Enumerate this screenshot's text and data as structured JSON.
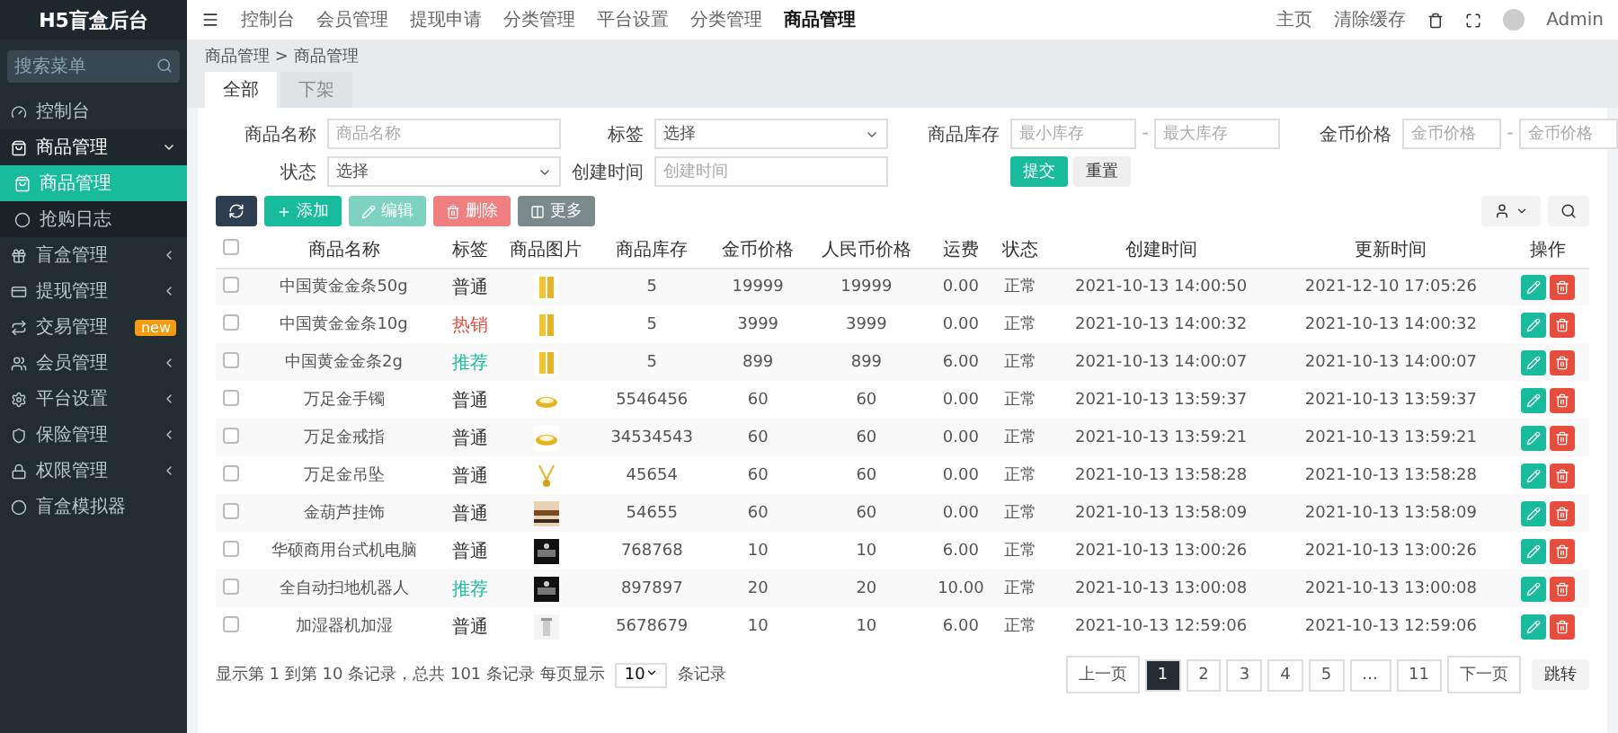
{
  "app_title": "H5盲盒后台",
  "sidebar": {
    "search": {
      "placeholder": "搜索菜单"
    },
    "items": [
      {
        "label": "控制台",
        "expanded": false,
        "selected": false
      },
      {
        "label": "商品管理",
        "expanded": true,
        "selected": false,
        "children": [
          {
            "label": "商品管理",
            "selected": true
          },
          {
            "label": "抢购日志",
            "selected": false
          }
        ]
      },
      {
        "label": "盲盒管理",
        "expanded": false,
        "selected": false
      },
      {
        "label": "提现管理",
        "expanded": false,
        "selected": false
      },
      {
        "label": "交易管理",
        "expanded": false,
        "selected": false,
        "badge": "new"
      },
      {
        "label": "会员管理",
        "expanded": false,
        "selected": false
      },
      {
        "label": "平台设置",
        "expanded": false,
        "selected": false
      },
      {
        "label": "保险管理",
        "expanded": false,
        "selected": false
      },
      {
        "label": "权限管理",
        "expanded": false,
        "selected": false
      },
      {
        "label": "盲盒模拟器",
        "expanded": false,
        "selected": false
      }
    ]
  },
  "top_nav": [
    {
      "label": "控制台",
      "selected": false
    },
    {
      "label": "会员管理",
      "selected": false
    },
    {
      "label": "提现申请",
      "selected": false
    },
    {
      "label": "分类管理",
      "selected": false
    },
    {
      "label": "平台设置",
      "selected": false
    },
    {
      "label": "分类管理",
      "selected": false
    },
    {
      "label": "商品管理",
      "selected": true
    }
  ],
  "top_right": {
    "home": "主页",
    "clear_cache": "清除缓存",
    "user": "Admin"
  },
  "breadcrumb": "商品管理 > 商品管理",
  "tabs": [
    {
      "label": "全部",
      "selected": true
    },
    {
      "label": "下架",
      "selected": false
    }
  ],
  "filters": {
    "name": {
      "label": "商品名称",
      "placeholder": "商品名称"
    },
    "tag": {
      "label": "标签",
      "value": "选择"
    },
    "stock": {
      "label": "商品库存",
      "min": {
        "placeholder": "最小库存"
      },
      "separator": "-",
      "max": {
        "placeholder": "最大库存"
      }
    },
    "price": {
      "label": "金币价格",
      "min": {
        "placeholder": "金币价格"
      },
      "separator": "-",
      "max": {
        "placeholder": "金币价格"
      }
    },
    "status": {
      "label": "状态",
      "value": "选择"
    },
    "created": {
      "label": "创建时间",
      "placeholder": "创建时间"
    },
    "submit": "提交",
    "reset": "重置"
  },
  "toolbar": [
    "添加",
    "编辑",
    "删除",
    "更多"
  ],
  "table": {
    "all_checked": false,
    "columns": [
      "商品名称",
      "标签",
      "商品图片",
      "商品库存",
      "金币价格",
      "人民币价格",
      "运费",
      "状态",
      "创建时间",
      "更新时间",
      "操作"
    ],
    "rows": [
      {
        "checked": false,
        "name": "中国黄金金条50g",
        "tag": {
          "label": "普通",
          "color": "#333333"
        },
        "stock": "5",
        "coin": "19999",
        "rmb": "19999",
        "freight": "0.00",
        "status": "正常",
        "created": "2021-10-13 14:00:50",
        "updated": "2021-12-10 17:05:26"
      },
      {
        "checked": false,
        "name": "中国黄金金条10g",
        "tag": {
          "label": "热销",
          "color": "#e74c3c"
        },
        "stock": "5",
        "coin": "3999",
        "rmb": "3999",
        "freight": "0.00",
        "status": "正常",
        "created": "2021-10-13 14:00:32",
        "updated": "2021-10-13 14:00:32"
      },
      {
        "checked": false,
        "name": "中国黄金金条2g",
        "tag": {
          "label": "推荐",
          "color": "#18bc9c"
        },
        "stock": "5",
        "coin": "899",
        "rmb": "899",
        "freight": "6.00",
        "status": "正常",
        "created": "2021-10-13 14:00:07",
        "updated": "2021-10-13 14:00:07"
      },
      {
        "checked": false,
        "name": "万足金手镯",
        "tag": {
          "label": "普通",
          "color": "#333333"
        },
        "stock": "5546456",
        "coin": "60",
        "rmb": "60",
        "freight": "0.00",
        "status": "正常",
        "created": "2021-10-13 13:59:37",
        "updated": "2021-10-13 13:59:37"
      },
      {
        "checked": false,
        "name": "万足金戒指",
        "tag": {
          "label": "普通",
          "color": "#333333"
        },
        "stock": "34534543",
        "coin": "60",
        "rmb": "60",
        "freight": "0.00",
        "status": "正常",
        "created": "2021-10-13 13:59:21",
        "updated": "2021-10-13 13:59:21"
      },
      {
        "checked": false,
        "name": "万足金吊坠",
        "tag": {
          "label": "普通",
          "color": "#333333"
        },
        "stock": "45654",
        "coin": "60",
        "rmb": "60",
        "freight": "0.00",
        "status": "正常",
        "created": "2021-10-13 13:58:28",
        "updated": "2021-10-13 13:58:28"
      },
      {
        "checked": false,
        "name": "金葫芦挂饰",
        "tag": {
          "label": "普通",
          "color": "#333333"
        },
        "stock": "54655",
        "coin": "60",
        "rmb": "60",
        "freight": "0.00",
        "status": "正常",
        "created": "2021-10-13 13:58:09",
        "updated": "2021-10-13 13:58:09"
      },
      {
        "checked": false,
        "name": "华硕商用台式机电脑",
        "tag": {
          "label": "普通",
          "color": "#333333"
        },
        "stock": "768768",
        "coin": "10",
        "rmb": "10",
        "freight": "6.00",
        "status": "正常",
        "created": "2021-10-13 13:00:26",
        "updated": "2021-10-13 13:00:26"
      },
      {
        "checked": false,
        "name": "全自动扫地机器人",
        "tag": {
          "label": "推荐",
          "color": "#18bc9c"
        },
        "stock": "897897",
        "coin": "20",
        "rmb": "20",
        "freight": "10.00",
        "status": "正常",
        "created": "2021-10-13 13:00:08",
        "updated": "2021-10-13 13:00:08"
      },
      {
        "checked": false,
        "name": "加湿器机加湿",
        "tag": {
          "label": "普通",
          "color": "#333333"
        },
        "stock": "5678679",
        "coin": "10",
        "rmb": "10",
        "freight": "6.00",
        "status": "正常",
        "created": "2021-10-13 12:59:06",
        "updated": "2021-10-13 12:59:06"
      }
    ]
  },
  "footer": {
    "summary": "显示第 1 到第 10 条记录，总共 101 条记录 每页显示",
    "page_size": "10",
    "suffix": "条记录"
  },
  "pagination": [
    {
      "label": "上一页",
      "selected": false
    },
    {
      "label": "1",
      "selected": true
    },
    {
      "label": "2",
      "selected": false
    },
    {
      "label": "3",
      "selected": false
    },
    {
      "label": "4",
      "selected": false
    },
    {
      "label": "5",
      "selected": false
    },
    {
      "label": "…",
      "selected": false
    },
    {
      "label": "11",
      "selected": false
    },
    {
      "label": "下一页",
      "selected": false
    }
  ],
  "jump": "跳转"
}
